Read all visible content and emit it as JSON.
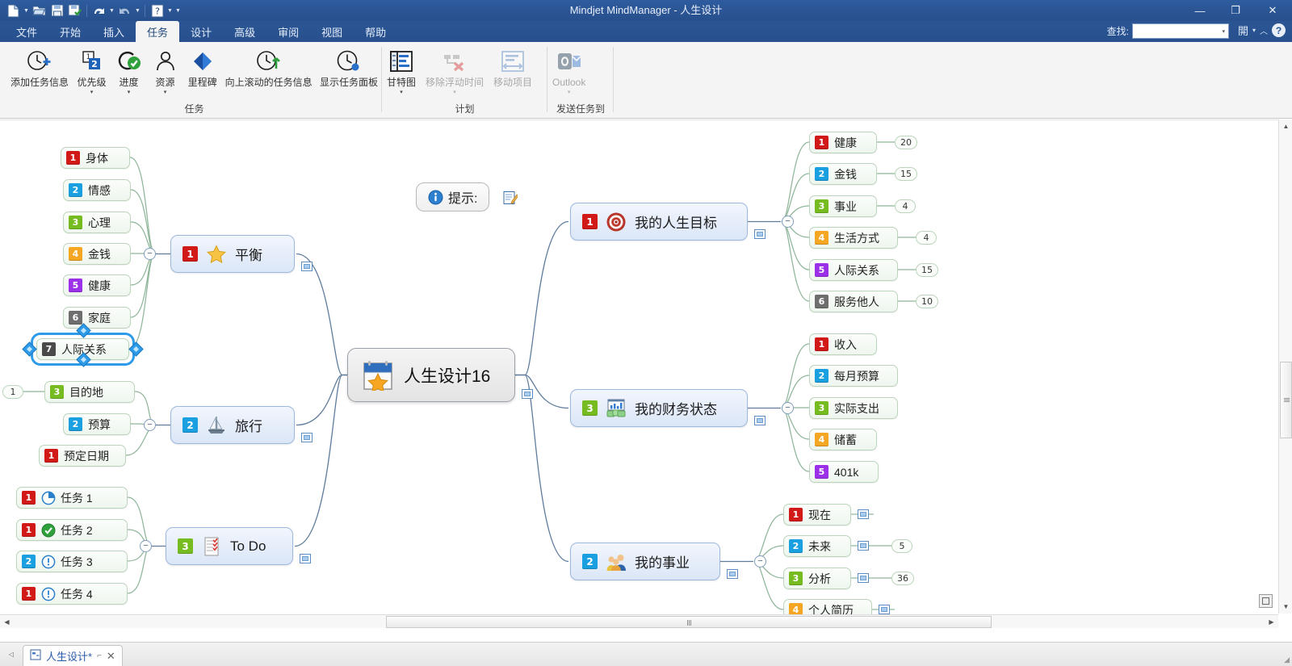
{
  "window": {
    "title": "Mindjet MindManager - 人生设计",
    "minimize": "—",
    "restore": "❐",
    "close": "✕"
  },
  "quick_access": {
    "new_label": "新建",
    "open_label": "打开",
    "save_label": "保存",
    "saveas_label": "另存为",
    "undo_label": "撤消",
    "redo_label": "恢复",
    "help_label": "帮助",
    "customize_label": "自定义快速访问工具栏"
  },
  "menu": {
    "items": [
      {
        "label": "文件",
        "active": false
      },
      {
        "label": "开始",
        "active": false
      },
      {
        "label": "插入",
        "active": false
      },
      {
        "label": "任务",
        "active": true
      },
      {
        "label": "设计",
        "active": false
      },
      {
        "label": "高级",
        "active": false
      },
      {
        "label": "审阅",
        "active": false
      },
      {
        "label": "视图",
        "active": false
      },
      {
        "label": "帮助",
        "active": false
      }
    ]
  },
  "find": {
    "label": "查找:",
    "value": "",
    "placeholder": "",
    "dropdown_glyph": "▾",
    "collapse_glyph": "︿",
    "help_glyph": "?"
  },
  "ribbon": {
    "groups": [
      {
        "title": "任务",
        "buttons": [
          {
            "label": "添加任务信息",
            "icon": "clock-plus-icon",
            "arrow": "",
            "disabled": false
          },
          {
            "label": "优先级",
            "icon": "priority-icon",
            "arrow": "▾",
            "disabled": false
          },
          {
            "label": "进度",
            "icon": "progress-check-icon",
            "arrow": "▾",
            "disabled": false
          },
          {
            "label": "资源",
            "icon": "person-icon",
            "arrow": "▾",
            "disabled": false
          },
          {
            "label": "里程碑",
            "icon": "milestone-diamond-icon",
            "arrow": "",
            "disabled": false
          },
          {
            "label": "向上滚动的任务信息",
            "icon": "clock-up-icon",
            "arrow": "",
            "disabled": false
          },
          {
            "label": "显示任务面板",
            "icon": "clock-panel-icon",
            "arrow": "",
            "disabled": false
          }
        ]
      },
      {
        "title": "计划",
        "buttons": [
          {
            "label": "甘特图",
            "icon": "gantt-chart-icon",
            "arrow": "▾",
            "disabled": false
          },
          {
            "label": "移除浮动时间",
            "icon": "remove-slack-icon",
            "arrow": "▾",
            "disabled": true
          },
          {
            "label": "移动项目",
            "icon": "move-project-icon",
            "arrow": "",
            "disabled": true
          }
        ]
      },
      {
        "title": "发送任务到",
        "buttons": [
          {
            "label": "Outlook",
            "icon": "outlook-icon",
            "arrow": "▾",
            "disabled": true
          }
        ]
      }
    ]
  },
  "map": {
    "callout": {
      "label": "提示:",
      "info_icon": "info-icon",
      "note_icon": "note-edit-icon"
    },
    "central": {
      "label": "人生设计16",
      "icon": "calendar-star-icon"
    },
    "branches": [
      {
        "id": "balance",
        "label": "平衡",
        "priority": "1",
        "priority_color": "#d11a17",
        "icon": "star-icon",
        "side": "left",
        "has_note": true,
        "collapse": "−",
        "children": [
          {
            "label": "身体",
            "priority": "1",
            "color": "#d11a17"
          },
          {
            "label": "情感",
            "priority": "2",
            "color": "#1a9fe0"
          },
          {
            "label": "心理",
            "priority": "3",
            "color": "#76bc21"
          },
          {
            "label": "金钱",
            "priority": "4",
            "color": "#f5a623"
          },
          {
            "label": "健康",
            "priority": "5",
            "color": "#9b30e8"
          },
          {
            "label": "家庭",
            "priority": "6",
            "color": "#6e6e6e"
          },
          {
            "label": "人际关系",
            "priority": "7",
            "color": "#4a4a4a",
            "selected": true
          }
        ]
      },
      {
        "id": "travel",
        "label": "旅行",
        "priority": "2",
        "priority_color": "#1a9fe0",
        "icon": "sailboat-icon",
        "side": "left",
        "has_note": true,
        "collapse": "−",
        "children": [
          {
            "label": "目的地",
            "priority": "3",
            "color": "#76bc21",
            "badge": "1",
            "badge_side": "left"
          },
          {
            "label": "预算",
            "priority": "2",
            "color": "#1a9fe0"
          },
          {
            "label": "预定日期",
            "priority": "1",
            "color": "#d11a17"
          }
        ]
      },
      {
        "id": "todo",
        "label": "To Do",
        "priority": "3",
        "priority_color": "#76bc21",
        "icon": "checklist-icon",
        "side": "left",
        "has_note": true,
        "collapse": "−",
        "children": [
          {
            "label": "任务 1",
            "priority": "1",
            "color": "#d11a17",
            "marker": "progress-quarter-icon"
          },
          {
            "label": "任务 2",
            "priority": "1",
            "color": "#d11a17",
            "marker": "progress-complete-icon"
          },
          {
            "label": "任务 3",
            "priority": "2",
            "color": "#1a9fe0",
            "marker": "progress-zero-icon"
          },
          {
            "label": "任务 4",
            "priority": "1",
            "color": "#d11a17",
            "marker": "progress-zero-icon"
          }
        ]
      },
      {
        "id": "goals",
        "label": "我的人生目标",
        "priority": "1",
        "priority_color": "#d11a17",
        "icon": "target-icon",
        "side": "right",
        "has_note": true,
        "collapse": "−",
        "children": [
          {
            "label": "健康",
            "priority": "1",
            "color": "#d11a17",
            "badge": "20"
          },
          {
            "label": "金钱",
            "priority": "2",
            "color": "#1a9fe0",
            "badge": "15"
          },
          {
            "label": "事业",
            "priority": "3",
            "color": "#76bc21",
            "badge": "4"
          },
          {
            "label": "生活方式",
            "priority": "4",
            "color": "#f5a623",
            "badge": "4"
          },
          {
            "label": "人际关系",
            "priority": "5",
            "color": "#9b30e8",
            "badge": "15"
          },
          {
            "label": "服务他人",
            "priority": "6",
            "color": "#6e6e6e",
            "badge": "10"
          }
        ]
      },
      {
        "id": "finance",
        "label": "我的财务状态",
        "priority": "3",
        "priority_color": "#76bc21",
        "icon": "money-chart-icon",
        "side": "right",
        "has_note": true,
        "collapse": "−",
        "children": [
          {
            "label": "收入",
            "priority": "1",
            "color": "#d11a17"
          },
          {
            "label": "每月预算",
            "priority": "2",
            "color": "#1a9fe0"
          },
          {
            "label": "实际支出",
            "priority": "3",
            "color": "#76bc21"
          },
          {
            "label": "储蓄",
            "priority": "4",
            "color": "#f5a623"
          },
          {
            "label": "401k",
            "priority": "5",
            "color": "#9b30e8"
          }
        ]
      },
      {
        "id": "career",
        "label": "我的事业",
        "priority": "2",
        "priority_color": "#1a9fe0",
        "icon": "people-icon",
        "side": "right",
        "has_note": true,
        "collapse": "−",
        "children": [
          {
            "label": "现在",
            "priority": "1",
            "color": "#d11a17",
            "note": true
          },
          {
            "label": "未来",
            "priority": "2",
            "color": "#1a9fe0",
            "note": true,
            "badge": "5"
          },
          {
            "label": "分析",
            "priority": "3",
            "color": "#76bc21",
            "note": true,
            "badge": "36"
          },
          {
            "label": "个人简历",
            "priority": "4",
            "color": "#f5a623",
            "note": true
          }
        ]
      }
    ]
  },
  "statusbar": {
    "tab_label": "人生设计*",
    "tab_icon": "map-doc-icon",
    "tab_pin": "⌐",
    "tab_close": "✕",
    "nav_prev": "◁",
    "nav_next": "▷"
  },
  "scroll": {
    "up": "▲",
    "down": "▼",
    "left": "◀",
    "right": "▶",
    "fit_label": "适合窗口"
  }
}
